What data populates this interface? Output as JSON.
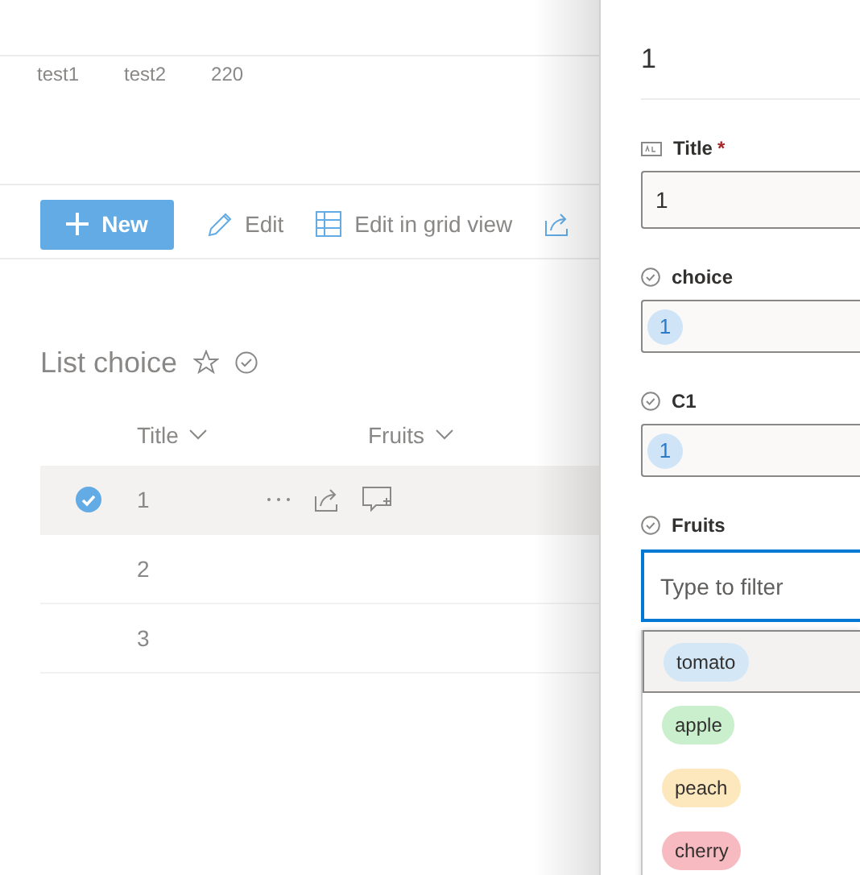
{
  "top_row": [
    "test1",
    "test2",
    "220"
  ],
  "command_bar": [
    {
      "kind": "new",
      "label": "New"
    },
    {
      "kind": "edit",
      "label": "Edit"
    },
    {
      "kind": "grid",
      "label": "Edit in grid view"
    },
    {
      "kind": "share"
    }
  ],
  "list": {
    "title": "List choice",
    "favorite": false,
    "columns": [
      "Title",
      "Fruits"
    ],
    "rows": [
      {
        "title": "1",
        "selected": true
      },
      {
        "title": "2",
        "selected": false
      },
      {
        "title": "3",
        "selected": false
      }
    ]
  },
  "panel": {
    "title": "1",
    "fields": [
      {
        "kind": "text",
        "label": "Title",
        "required_mark": "*",
        "value": "1"
      },
      {
        "kind": "choice",
        "label": "choice",
        "chips": [
          "1"
        ]
      },
      {
        "kind": "choice",
        "label": "C1",
        "chips": [
          "1"
        ]
      },
      {
        "kind": "filter",
        "label": "Fruits",
        "placeholder": "Type to filter",
        "focused": true
      }
    ],
    "options": [
      {
        "label": "tomato",
        "color": "#d4e7f6",
        "selected": true
      },
      {
        "label": "apple",
        "color": "#caefcc",
        "selected": false
      },
      {
        "label": "peach",
        "color": "#fde7bd",
        "selected": false
      },
      {
        "label": "cherry",
        "color": "#f8bac1",
        "selected": false
      }
    ]
  }
}
